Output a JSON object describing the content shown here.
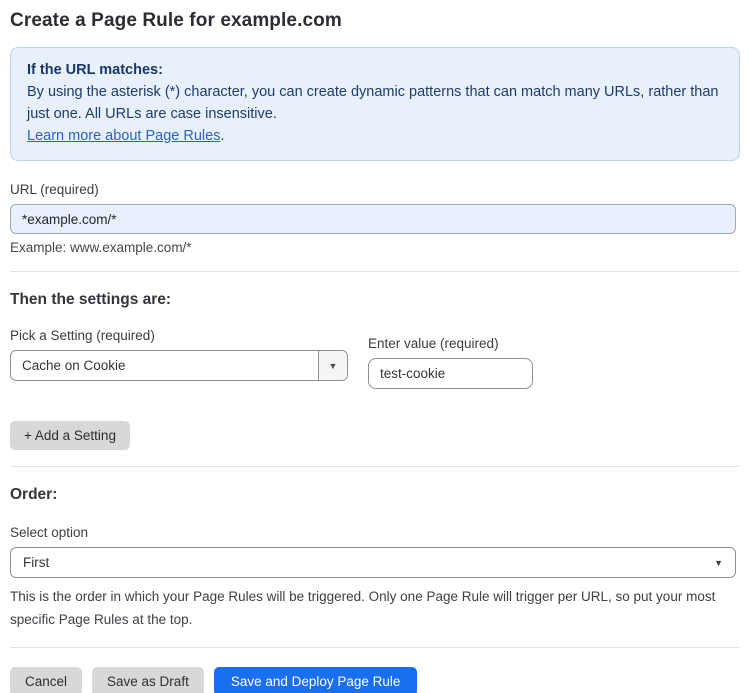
{
  "page": {
    "title": "Create a Page Rule for example.com"
  },
  "info_box": {
    "heading": "If the URL matches:",
    "body": "By using the asterisk (*) character, you can create dynamic patterns that can match many URLs, rather than just one. All URLs are case insensitive.",
    "link_label": "Learn more about Page Rules",
    "link_suffix": "."
  },
  "url_field": {
    "label": "URL (required)",
    "value": "*example.com/*",
    "example": "Example: www.example.com/*"
  },
  "settings": {
    "heading": "Then the settings are:",
    "setting_label": "Pick a Setting (required)",
    "setting_selected": "Cache on Cookie",
    "value_label": "Enter value (required)",
    "value_text": "test-cookie",
    "add_button_label": "+ Add a Setting"
  },
  "order": {
    "heading": "Order:",
    "label": "Select option",
    "selected": "First",
    "help": "This is the order in which your Page Rules will be triggered. Only one Page Rule will trigger per URL, so put your most specific Page Rules at the top."
  },
  "footer": {
    "cancel_label": "Cancel",
    "save_draft_label": "Save as Draft",
    "save_deploy_label": "Save and Deploy Page Rule"
  },
  "icons": {
    "dropdown_arrow": "▼"
  },
  "colors": {
    "primary_button": "#1a6ef0",
    "info_background": "#e8f1fb",
    "info_text": "#1d3c6e",
    "link": "#2a62c8",
    "autofill_input_background": "#e8f0fe",
    "gray_button": "#d8d8d8"
  }
}
